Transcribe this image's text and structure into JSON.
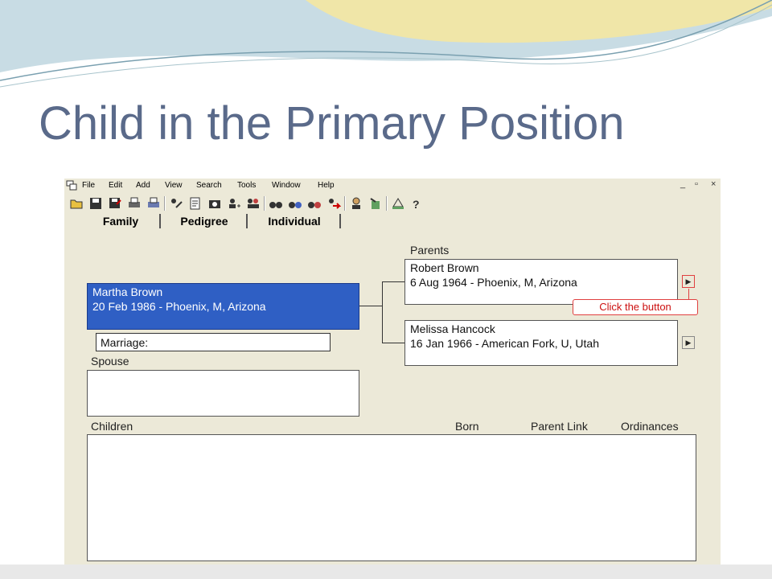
{
  "slide": {
    "title": "Child in the Primary Position"
  },
  "app": {
    "menu": [
      "File",
      "Edit",
      "Add",
      "View",
      "Search",
      "Tools",
      "Window",
      "Help"
    ],
    "window_controls": [
      "_",
      "▫",
      "×"
    ],
    "toolbar_icons": [
      "open-folder-icon",
      "save-icon",
      "save-as-icon",
      "print-icon",
      "print-preview-icon",
      "individual-edit-icon",
      "notes-icon",
      "camera-icon",
      "add-individual-icon",
      "add-family-icon",
      "search-binoculars-icon",
      "find-individual-icon",
      "find-family-icon",
      "go-to-icon",
      "person-icon",
      "export-icon",
      "pedigree-chart-icon",
      "help-icon"
    ],
    "tabs": [
      {
        "label": "Family",
        "active": true
      },
      {
        "label": "Pedigree",
        "active": false
      },
      {
        "label": "Individual",
        "active": false
      }
    ],
    "parents_label": "Parents",
    "father": {
      "name": "Robert Brown",
      "details": "6 Aug 1964 - Phoenix, M, Arizona"
    },
    "mother": {
      "name": "Melissa Hancock",
      "details": "16 Jan 1966 - American Fork, U, Utah"
    },
    "primary": {
      "name": "Martha Brown",
      "details": "20 Feb 1986 - Phoenix, M, Arizona"
    },
    "marriage_label": "Marriage:",
    "spouse_label": "Spouse",
    "children_headers": {
      "children": "Children",
      "born": "Born",
      "parent_link": "Parent Link",
      "ordinances": "Ordinances"
    },
    "callout": "Click the button",
    "arrow_glyph": "▶",
    "colors": {
      "primary_bg": "#2f5fc4",
      "callout": "#cc1010",
      "title": "#5a6a8a"
    }
  }
}
